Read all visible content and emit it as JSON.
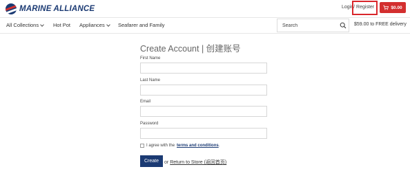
{
  "brand": {
    "name": "MARINE ALLIANCE",
    "logo_icon": "ship-logo-icon",
    "color": "#1b3a73"
  },
  "header": {
    "login_label": "Login",
    "separator": "/",
    "register_label": "Register",
    "cart_total": "$0.00",
    "cart_icon": "cart-icon",
    "accent": "#d32f2f"
  },
  "nav": {
    "items": [
      {
        "label": "All Collections",
        "has_dropdown": true
      },
      {
        "label": "Hot Pot",
        "has_dropdown": false
      },
      {
        "label": "Appliances",
        "has_dropdown": true
      },
      {
        "label": "Seafarer and Family",
        "has_dropdown": false
      }
    ],
    "search": {
      "placeholder": "Search",
      "icon": "search-icon"
    },
    "shipping_note": "$59.00 to FREE delivery"
  },
  "form": {
    "title": "Create Account | 创建账号",
    "fields": [
      {
        "label": "First Name",
        "value": ""
      },
      {
        "label": "Last Name",
        "value": ""
      },
      {
        "label": "Email",
        "value": ""
      },
      {
        "label": "Password",
        "value": ""
      }
    ],
    "agree_prefix": "I agree with the",
    "agree_link": "terms and conditions",
    "agree_suffix": ".",
    "submit_label": "Create",
    "or_text": "or",
    "return_label": "Return to Store (返回首页)"
  }
}
